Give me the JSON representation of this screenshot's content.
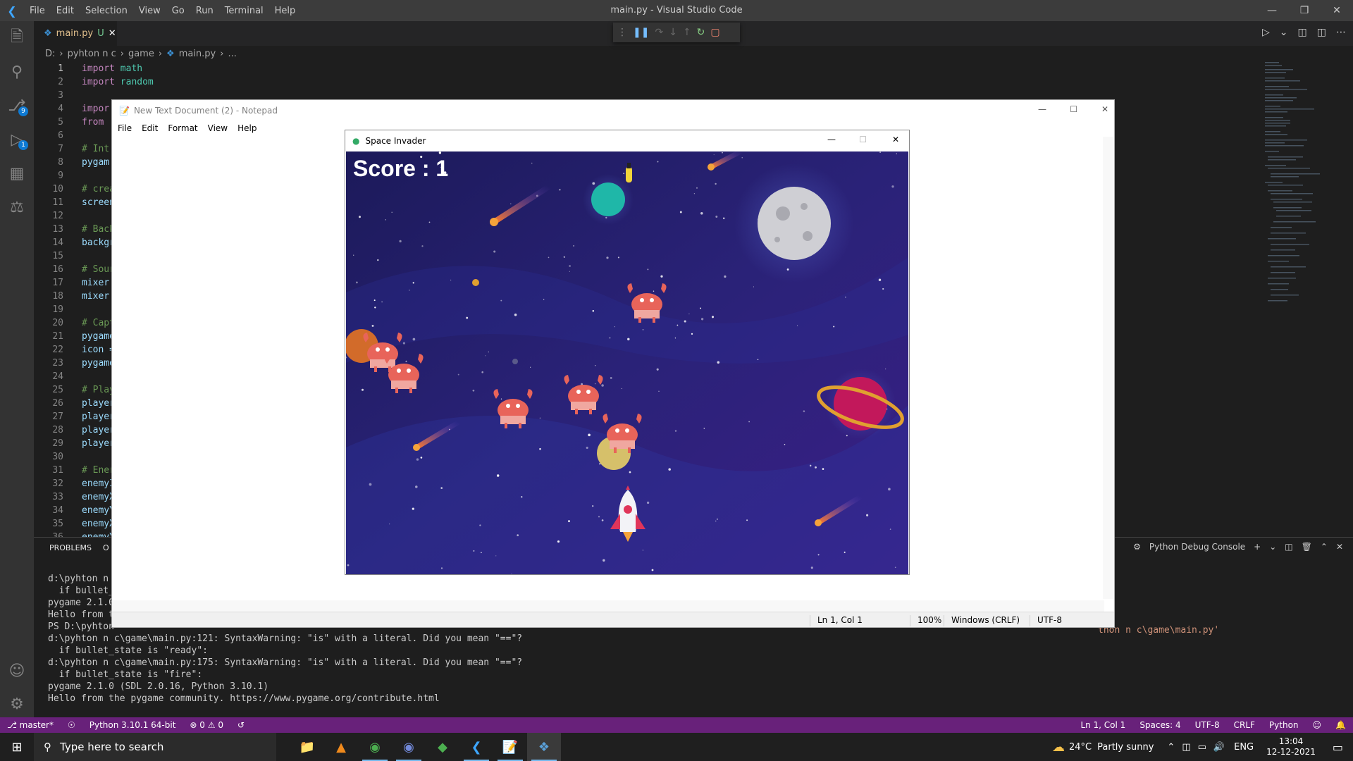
{
  "vscode": {
    "menu": [
      "File",
      "Edit",
      "Selection",
      "View",
      "Go",
      "Run",
      "Terminal",
      "Help"
    ],
    "title": "main.py - Visual Studio Code",
    "tab": {
      "name": "main.py",
      "status": "U"
    },
    "breadcrumb": [
      "D:",
      "pyhton n c",
      "game",
      "main.py",
      "..."
    ],
    "badges": {
      "source_control": "9",
      "debug": "1"
    },
    "code_lines": [
      {
        "n": "1",
        "t": "import math"
      },
      {
        "n": "2",
        "t": "import random"
      },
      {
        "n": "3",
        "t": ""
      },
      {
        "n": "4",
        "t": "impor"
      },
      {
        "n": "5",
        "t": "from"
      },
      {
        "n": "6",
        "t": ""
      },
      {
        "n": "7",
        "t": "# Int"
      },
      {
        "n": "8",
        "t": "pygam"
      },
      {
        "n": "9",
        "t": ""
      },
      {
        "n": "10",
        "t": "# crea"
      },
      {
        "n": "11",
        "t": "screen"
      },
      {
        "n": "12",
        "t": ""
      },
      {
        "n": "13",
        "t": "# Back"
      },
      {
        "n": "14",
        "t": "backgr"
      },
      {
        "n": "15",
        "t": ""
      },
      {
        "n": "16",
        "t": "# Sour"
      },
      {
        "n": "17",
        "t": "mixer."
      },
      {
        "n": "18",
        "t": "mixer."
      },
      {
        "n": "19",
        "t": ""
      },
      {
        "n": "20",
        "t": "# Capt"
      },
      {
        "n": "21",
        "t": "pygame"
      },
      {
        "n": "22",
        "t": "icon ="
      },
      {
        "n": "23",
        "t": "pygame"
      },
      {
        "n": "24",
        "t": ""
      },
      {
        "n": "25",
        "t": "# Play"
      },
      {
        "n": "26",
        "t": "player"
      },
      {
        "n": "27",
        "t": "player"
      },
      {
        "n": "28",
        "t": "player"
      },
      {
        "n": "29",
        "t": "player"
      },
      {
        "n": "30",
        "t": ""
      },
      {
        "n": "31",
        "t": "# Ener"
      },
      {
        "n": "32",
        "t": "enemyI"
      },
      {
        "n": "33",
        "t": "enemyX"
      },
      {
        "n": "34",
        "t": "enemyY"
      },
      {
        "n": "35",
        "t": "enemyX"
      },
      {
        "n": "36",
        "t": "enemyY"
      }
    ],
    "panel": {
      "tabs": [
        "PROBLEMS",
        "O"
      ],
      "console": "Python Debug Console",
      "right_path": "thon n c\\game\\main.py'",
      "terminal": [
        "d:\\pyhton n c",
        "  if bullet_s",
        "pygame 2.1.0",
        "Hello from th",
        "PS D:\\pyhton",
        "d:\\pyhton n c\\game\\main.py:121: SyntaxWarning: \"is\" with a literal. Did you mean \"==\"?",
        "  if bullet_state is \"ready\":",
        "d:\\pyhton n c\\game\\main.py:175: SyntaxWarning: \"is\" with a literal. Did you mean \"==\"?",
        "  if bullet_state is \"fire\":",
        "pygame 2.1.0 (SDL 2.0.16, Python 3.10.1)",
        "Hello from the pygame community. https://www.pygame.org/contribute.html"
      ]
    },
    "status": {
      "branch": "master*",
      "interpreter": "Python 3.10.1 64-bit",
      "errors": "0",
      "warnings": "0",
      "position": "Ln 1, Col 1",
      "spaces": "Spaces: 4",
      "encoding": "UTF-8",
      "eol": "CRLF",
      "language": "Python"
    }
  },
  "notepad": {
    "title": "New Text Document (2) - Notepad",
    "menu": [
      "File",
      "Edit",
      "Format",
      "View",
      "Help"
    ],
    "status": {
      "position": "Ln 1, Col 1",
      "zoom": "100%",
      "eol": "Windows (CRLF)",
      "encoding": "UTF-8"
    }
  },
  "game": {
    "title": "Space Invader",
    "score_text": "Score : 1",
    "colors": {
      "bg_top": "#22185e",
      "bg_bottom": "#351f8a",
      "crab": "#e8645a"
    }
  },
  "taskbar": {
    "search_placeholder": "Type here to search",
    "weather": "24°C",
    "weather_text": "Partly sunny",
    "lang": "ENG",
    "time": "13:04",
    "date": "12-12-2021"
  }
}
